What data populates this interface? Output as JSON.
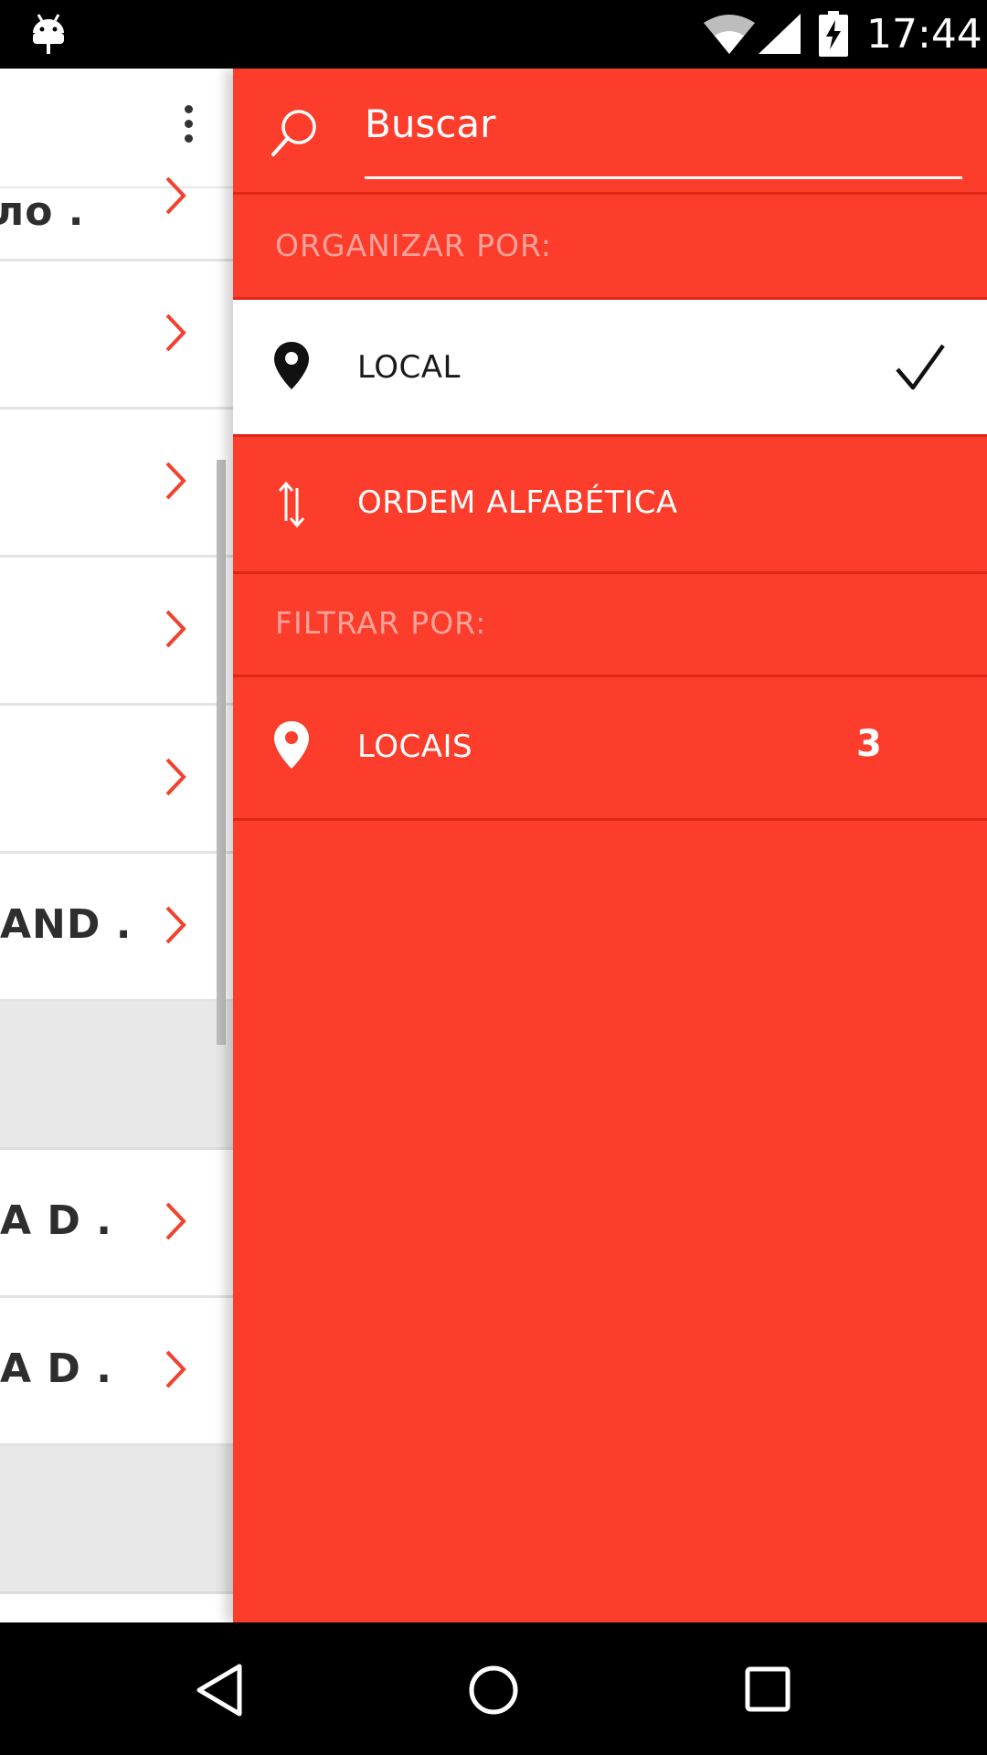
{
  "status_bar": {
    "time": "17:44",
    "icons": [
      "android-debug-icon",
      "wifi-icon",
      "signal-icon",
      "battery-charging-icon"
    ]
  },
  "background_list": {
    "rows": [
      {
        "text": "ло .",
        "has_chevron": true
      },
      {
        "text": "",
        "has_chevron": true
      },
      {
        "text": "",
        "has_chevron": true
      },
      {
        "text": "",
        "has_chevron": true
      },
      {
        "text": "",
        "has_chevron": true
      },
      {
        "text": "AND .",
        "has_chevron": true
      },
      {
        "text": "A D .",
        "has_chevron": true
      },
      {
        "text": "A D .",
        "has_chevron": true
      }
    ]
  },
  "drawer": {
    "search": {
      "placeholder": "Buscar",
      "value": ""
    },
    "sort_header": "ORGANIZAR POR:",
    "sort_options": [
      {
        "label": "LOCAL",
        "icon": "location-pin-icon",
        "selected": true
      },
      {
        "label": "ORDEM ALFABÉTICA",
        "icon": "sort-arrows-icon",
        "selected": false
      }
    ],
    "filter_header": "FILTRAR POR:",
    "filter_options": [
      {
        "label": "LOCAIS",
        "icon": "location-pin-icon",
        "count": "3"
      }
    ]
  },
  "colors": {
    "accent": "#fc3d2b",
    "divider": "#e02616",
    "header_text": "#fda39a"
  },
  "nav_bar": {
    "buttons": [
      "back-icon",
      "home-icon",
      "recents-icon"
    ]
  }
}
